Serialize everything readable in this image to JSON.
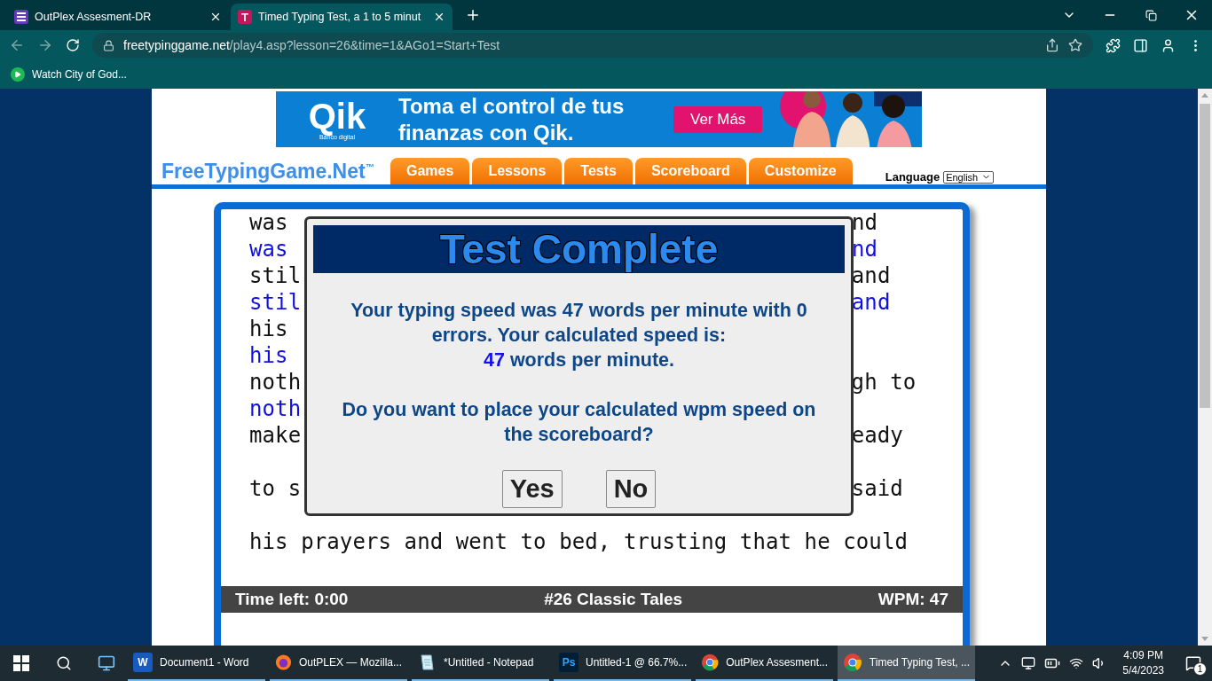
{
  "browser": {
    "tabs": [
      {
        "title": "OutPlex Assesment-DR",
        "kind": "forms",
        "selected": false
      },
      {
        "title": "Timed Typing Test, a 1 to 5 minut",
        "kind": "letter",
        "letter": "T",
        "selected": true
      }
    ],
    "address": {
      "host": "freetypinggame.net",
      "path": "/play4.asp?lesson=26&time=1&AGo1=Start+Test"
    },
    "bookmarks": [
      {
        "label": "Watch City of God..."
      }
    ]
  },
  "ad": {
    "logo": "Qik",
    "logo_caption": "Banco digital",
    "headline": [
      "Toma el control de tus",
      "finanzas con Qik."
    ],
    "button": "Ver Más"
  },
  "site": {
    "logo": "FreeTypingGame.Net$^{™}$",
    "nav": [
      "Games",
      "Lessons",
      "Tests",
      "Scoreboard",
      "Customize"
    ],
    "language_label": "Language",
    "language": "English"
  },
  "text_lines": [
    {
      "left": "was",
      "right": "nd",
      "typed": false
    },
    {
      "left": "was",
      "right": "nd",
      "typed": true
    },
    {
      "left": "stil",
      "right": "and",
      "typed": false
    },
    {
      "left": "stil",
      "right": "and",
      "typed": true
    },
    {
      "left": "his",
      "typed": false
    },
    {
      "left": "his",
      "typed": true
    },
    {
      "left": "noth",
      "right": "gh to",
      "typed": false
    },
    {
      "left": "noth",
      "typed": true
    },
    {
      "left": "make",
      "right": "eady",
      "typed": false,
      "blank_after": true
    },
    {
      "left": "to s",
      "right": "said",
      "typed": false,
      "blank_after": true
    },
    {
      "left": "his prayers and went to bed, trusting that he could",
      "typed": false
    }
  ],
  "status": {
    "time_left": "Time left: 0:00",
    "lesson": "#26 Classic Tales",
    "wpm": "WPM: 47"
  },
  "dialog": {
    "title": "Test Complete",
    "message": "Your typing speed was 47 words per minute with 0 errors. Your calculated speed is:",
    "speed": "47",
    "speed_unit": "words per minute.",
    "question": "Do you want to place your calculated wpm speed on the scoreboard?",
    "buttons": [
      "Yes",
      "No"
    ]
  },
  "taskbar": {
    "apps": [
      {
        "label": "Document1 - Word",
        "kind": "word",
        "icon_text": "W",
        "selected": false
      },
      {
        "label": "OutPLEX — Mozilla...",
        "kind": "firefox",
        "selected": false
      },
      {
        "label": "*Untitled - Notepad",
        "kind": "notepad",
        "selected": false
      },
      {
        "label": "Untitled-1 @ 66.7%...",
        "kind": "photoshop",
        "icon_text": "Ps",
        "selected": false
      },
      {
        "label": "OutPlex Assesment...",
        "kind": "chrome",
        "selected": false
      },
      {
        "label": "Timed Typing Test, ...",
        "kind": "chrome",
        "selected": true
      }
    ],
    "time": "4:09 PM",
    "date": "5/4/2023",
    "notifications": "1"
  }
}
